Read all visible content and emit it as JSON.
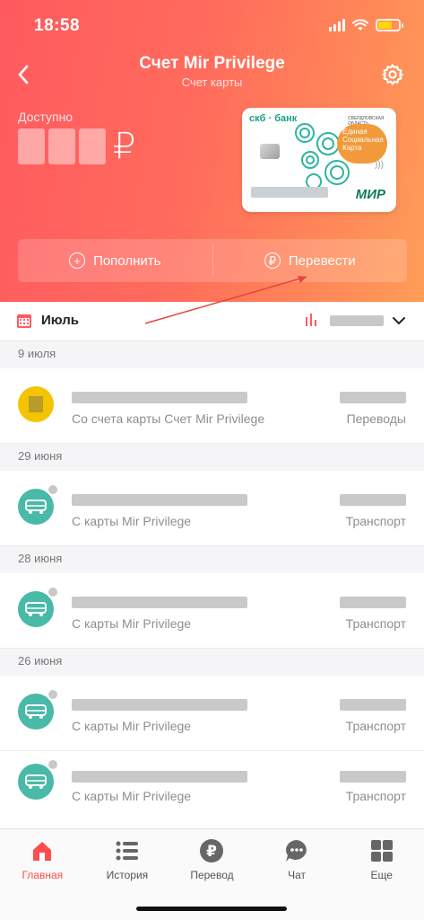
{
  "status_bar": {
    "time": "18:58"
  },
  "header": {
    "title": "Счет Mir Privilege",
    "subtitle": "Счет карты",
    "available_label": "Доступно",
    "currency_sign": "₽",
    "back_icon": "chevron-left-icon",
    "settings_icon": "gear-icon"
  },
  "card": {
    "bank": "скб · банк",
    "region": "СВЕРДЛОВСКАЯ ОБЛАСТЬ",
    "social_text": "Единая Социальная Карта",
    "payment_system": "МИР",
    "accent_color": "#1aa08a"
  },
  "actions": {
    "top_up_label": "Пополнить",
    "transfer_label": "Перевести"
  },
  "month_bar": {
    "month": "Июль"
  },
  "transactions": {
    "groups": [
      {
        "date": "9 июля",
        "items": [
          {
            "subtitle": "Со счета карты Счет Mir Privilege",
            "category": "Переводы",
            "icon": "avatar"
          }
        ]
      },
      {
        "date": "29 июня",
        "items": [
          {
            "subtitle": "С карты Mir Privilege",
            "category": "Транспорт",
            "icon": "bus-icon"
          }
        ]
      },
      {
        "date": "28 июня",
        "items": [
          {
            "subtitle": "С карты Mir Privilege",
            "category": "Транспорт",
            "icon": "bus-icon"
          }
        ]
      },
      {
        "date": "26 июня",
        "items": [
          {
            "subtitle": "С карты Mir Privilege",
            "category": "Транспорт",
            "icon": "bus-icon"
          },
          {
            "subtitle": "С карты Mir Privilege",
            "category": "Транспорт",
            "icon": "bus-icon"
          }
        ]
      }
    ]
  },
  "tab_bar": {
    "tabs": [
      {
        "label": "Главная",
        "icon": "home-icon"
      },
      {
        "label": "История",
        "icon": "list-icon"
      },
      {
        "label": "Перевод",
        "icon": "ruble-icon"
      },
      {
        "label": "Чат",
        "icon": "chat-icon"
      },
      {
        "label": "Еще",
        "icon": "grid-icon"
      }
    ],
    "active_color": "#ff4d4d"
  },
  "colors": {
    "header_start": "#ff5a5f",
    "header_end": "#ff9d58",
    "bus_icon_bg": "#49b9a8"
  }
}
